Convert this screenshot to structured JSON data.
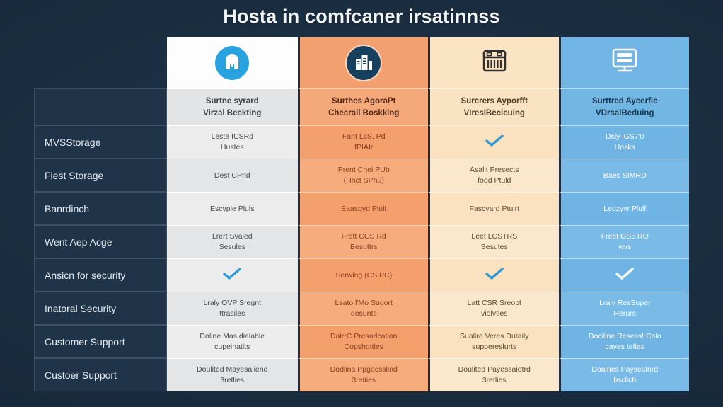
{
  "page": {
    "title": "Hosta in comfcaner irsatinnss",
    "background_color": "#1c2f42"
  },
  "columns": [
    {
      "key": "col1",
      "icon": "shield-m-logo-icon",
      "title_line1": "Surtne syrard",
      "title_line2": "Virzal Beckting",
      "accent": "#29a3e0",
      "background": "#ececec"
    },
    {
      "key": "col2",
      "icon": "server-building-icon",
      "title_line1": "Surthes AgoraPt",
      "title_line2": "Checrall Boskking",
      "accent": "#17405f",
      "background": "#f4a06c"
    },
    {
      "key": "col3",
      "icon": "server-rack-icon",
      "title_line1": "Surcrers Ayporfft",
      "title_line2": "VIresIBecicuing",
      "accent": "#3a3a3a",
      "background": "#fae2c0"
    },
    {
      "key": "col4",
      "icon": "desktop-monitor-icon",
      "title_line1": "Surttred Aycerfic",
      "title_line2": "VDrsalBeduing",
      "accent": "#ffffff",
      "background": "#6fb4e2"
    }
  ],
  "rows": [
    {
      "label": "MVSStorage",
      "cells": [
        {
          "type": "text",
          "line1": "Leste ICSRd",
          "line2": "Hustes"
        },
        {
          "type": "text",
          "line1": "Fant LsS, Pd",
          "line2": "fPIAIr"
        },
        {
          "type": "check"
        },
        {
          "type": "text",
          "line1": "Dsly iGS7'0",
          "line2": "Hosks"
        }
      ]
    },
    {
      "label": "Fiest Storage",
      "cells": [
        {
          "type": "text",
          "line1": "Dest CPnd",
          "line2": ""
        },
        {
          "type": "text",
          "line1": "Prent Cnei PUb",
          "line2": "(Hnct SPhu)"
        },
        {
          "type": "text",
          "line1": "Asalit Presects",
          "line2": "food Ptuld"
        },
        {
          "type": "text",
          "line1": "Baes SIMRD",
          "line2": ""
        }
      ]
    },
    {
      "label": "Banrdinch",
      "cells": [
        {
          "type": "text",
          "line1": "Escyple Pluls",
          "line2": ""
        },
        {
          "type": "text",
          "line1": "Eaasgyd Plult",
          "line2": ""
        },
        {
          "type": "text",
          "line1": "Fascyard Ptulrt",
          "line2": ""
        },
        {
          "type": "text",
          "line1": "Leozyyr Plulf",
          "line2": ""
        }
      ]
    },
    {
      "label": "Went Aep Acge",
      "cells": [
        {
          "type": "text",
          "line1": "Lrert Svaled",
          "line2": "Sesules"
        },
        {
          "type": "text",
          "line1": "Frett CCS Rd",
          "line2": "Besuttrs"
        },
        {
          "type": "text",
          "line1": "Leet LCSTRS",
          "line2": "Sesutes"
        },
        {
          "type": "text",
          "line1": "Freet GS5 RO",
          "line2": "wvs"
        }
      ]
    },
    {
      "label": "Ansicn for security",
      "cells": [
        {
          "type": "check"
        },
        {
          "type": "text",
          "line1": "Serwing (CS PC)",
          "line2": ""
        },
        {
          "type": "check"
        },
        {
          "type": "check"
        }
      ]
    },
    {
      "label": "Inatoral Security",
      "cells": [
        {
          "type": "text",
          "line1": "Lraly OVP Sregnt",
          "line2": "ttrasiles"
        },
        {
          "type": "text",
          "line1": "Lsato l'Mo Sugort",
          "line2": "dosunts"
        },
        {
          "type": "text",
          "line1": "Latt CSR Sreopt",
          "line2": "violvtles"
        },
        {
          "type": "text",
          "line1": "Lralv ResSuper",
          "line2": "Herurs"
        }
      ]
    },
    {
      "label": "Customer Support",
      "cells": [
        {
          "type": "text",
          "line1": "Doline Mas dialable",
          "line2": "cupeinatlts"
        },
        {
          "type": "text",
          "line1": "DalrrC Presarlcation",
          "line2": "Copshottles"
        },
        {
          "type": "text",
          "line1": "Sualire Veres Dutaily",
          "line2": "suppereslurts"
        },
        {
          "type": "text",
          "line1": "Dociline Resess! Calo",
          "line2": "cayes tefias"
        }
      ]
    },
    {
      "label": "Custoer Support",
      "cells": [
        {
          "type": "text",
          "line1": "Doulited Mayesaliend",
          "line2": "3retlies"
        },
        {
          "type": "text",
          "line1": "Dodlina Ppgecsslind",
          "line2": "3retiies"
        },
        {
          "type": "text",
          "line1": "Doulited Payessaiotrd",
          "line2": "3retlies"
        },
        {
          "type": "text",
          "line1": "Doalnes Payscatnrd",
          "line2": "bsclich"
        }
      ]
    }
  ]
}
